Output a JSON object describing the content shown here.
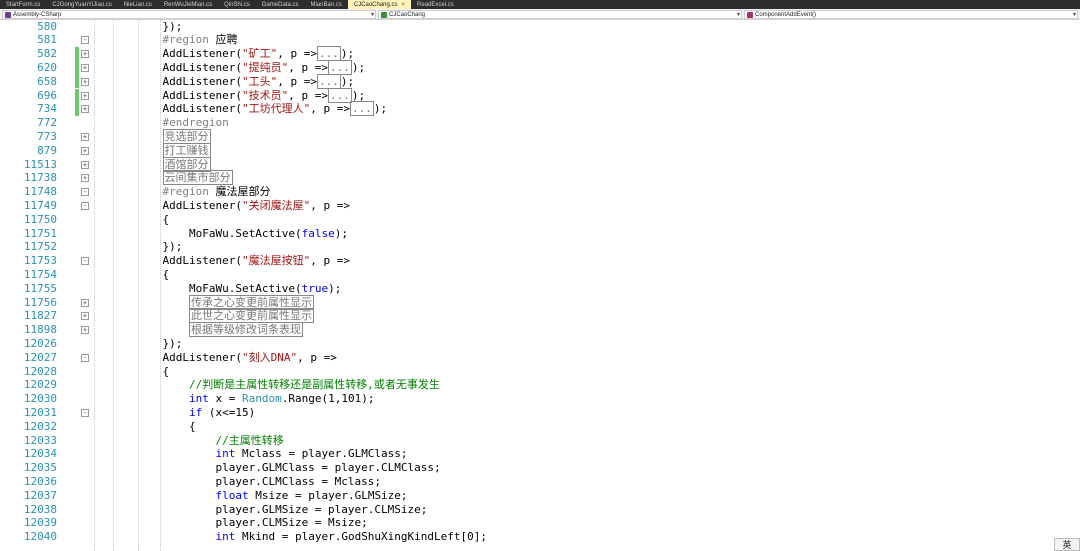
{
  "tabs": [
    {
      "label": "StartForm.cs",
      "active": false
    },
    {
      "label": "CJGongYuanYiJiao.cs",
      "active": false
    },
    {
      "label": "NieLian.cs",
      "active": false
    },
    {
      "label": "RenWuJieMian.cs",
      "active": false
    },
    {
      "label": "QinShi.cs",
      "active": false
    },
    {
      "label": "GameData.cs",
      "active": false
    },
    {
      "label": "MianBan.cs",
      "active": false
    },
    {
      "label": "CJCaoChang.cs",
      "active": true
    },
    {
      "label": "ReadExcel.cs",
      "active": false
    }
  ],
  "active_tab_close": "×",
  "navbar": {
    "project": "Assembly-CSharp",
    "class": "CJCaoChang",
    "member": "ComponentAddEvent()"
  },
  "ime_indicator": "英",
  "lines": [
    {
      "n": "580",
      "fold": "",
      "chg": false,
      "tokens": [
        {
          "t": "    });",
          "c": ""
        }
      ]
    },
    {
      "n": "581",
      "fold": "-",
      "chg": false,
      "tokens": [
        {
          "t": "    ",
          "c": ""
        },
        {
          "t": "#region",
          "c": "rg"
        },
        {
          "t": " 应聘",
          "c": ""
        }
      ]
    },
    {
      "n": "582",
      "fold": "+",
      "chg": true,
      "tokens": [
        {
          "t": "    AddListener(",
          "c": ""
        },
        {
          "t": "\"矿工\"",
          "c": "str"
        },
        {
          "t": ", p =>",
          "c": ""
        },
        {
          "t": "...",
          "c": "box"
        },
        {
          "t": ");",
          "c": ""
        }
      ]
    },
    {
      "n": "620",
      "fold": "+",
      "chg": true,
      "tokens": [
        {
          "t": "    AddListener(",
          "c": ""
        },
        {
          "t": "\"提纯员\"",
          "c": "str"
        },
        {
          "t": ", p =>",
          "c": ""
        },
        {
          "t": "...",
          "c": "box"
        },
        {
          "t": ");",
          "c": ""
        }
      ]
    },
    {
      "n": "658",
      "fold": "+",
      "chg": true,
      "tokens": [
        {
          "t": "    AddListener(",
          "c": ""
        },
        {
          "t": "\"工头\"",
          "c": "str"
        },
        {
          "t": ", p =>",
          "c": ""
        },
        {
          "t": "...",
          "c": "box"
        },
        {
          "t": ");",
          "c": ""
        }
      ]
    },
    {
      "n": "696",
      "fold": "+",
      "chg": true,
      "tokens": [
        {
          "t": "    AddListener(",
          "c": ""
        },
        {
          "t": "\"技术员\"",
          "c": "str"
        },
        {
          "t": ", p =>",
          "c": ""
        },
        {
          "t": "...",
          "c": "box"
        },
        {
          "t": ");",
          "c": ""
        }
      ]
    },
    {
      "n": "734",
      "fold": "+",
      "chg": true,
      "tokens": [
        {
          "t": "    AddListener(",
          "c": ""
        },
        {
          "t": "\"工坊代理人\"",
          "c": "str"
        },
        {
          "t": ", p =>",
          "c": ""
        },
        {
          "t": "...",
          "c": "box"
        },
        {
          "t": ");",
          "c": ""
        }
      ]
    },
    {
      "n": "772",
      "fold": "",
      "chg": false,
      "tokens": [
        {
          "t": "    ",
          "c": ""
        },
        {
          "t": "#endregion",
          "c": "rg"
        }
      ]
    },
    {
      "n": "773",
      "fold": "+",
      "chg": false,
      "tokens": [
        {
          "t": "    ",
          "c": ""
        },
        {
          "t": "竞选部分",
          "c": "box"
        }
      ]
    },
    {
      "n": "879",
      "fold": "+",
      "chg": false,
      "tokens": [
        {
          "t": "    ",
          "c": ""
        },
        {
          "t": "打工赚钱",
          "c": "box"
        }
      ]
    },
    {
      "n": "11513",
      "fold": "+",
      "chg": false,
      "tokens": [
        {
          "t": "    ",
          "c": ""
        },
        {
          "t": "酒馆部分",
          "c": "box"
        }
      ]
    },
    {
      "n": "11738",
      "fold": "+",
      "chg": false,
      "tokens": [
        {
          "t": "    ",
          "c": ""
        },
        {
          "t": "云间集市部分",
          "c": "box"
        }
      ]
    },
    {
      "n": "11748",
      "fold": "-",
      "chg": false,
      "tokens": [
        {
          "t": "    ",
          "c": ""
        },
        {
          "t": "#region",
          "c": "rg"
        },
        {
          "t": " 魔法屋部分",
          "c": ""
        }
      ]
    },
    {
      "n": "11749",
      "fold": "-",
      "chg": false,
      "tokens": [
        {
          "t": "    AddListener(",
          "c": ""
        },
        {
          "t": "\"关闭魔法屋\"",
          "c": "str"
        },
        {
          "t": ", p =>",
          "c": ""
        }
      ]
    },
    {
      "n": "11750",
      "fold": "",
      "chg": false,
      "tokens": [
        {
          "t": "    {",
          "c": ""
        }
      ]
    },
    {
      "n": "11751",
      "fold": "",
      "chg": false,
      "tokens": [
        {
          "t": "        MoFaWu.SetActive(",
          "c": ""
        },
        {
          "t": "false",
          "c": "kw"
        },
        {
          "t": ");",
          "c": ""
        }
      ]
    },
    {
      "n": "11752",
      "fold": "",
      "chg": false,
      "tokens": [
        {
          "t": "    });",
          "c": ""
        }
      ]
    },
    {
      "n": "11753",
      "fold": "-",
      "chg": false,
      "tokens": [
        {
          "t": "    AddListener(",
          "c": ""
        },
        {
          "t": "\"魔法屋按钮\"",
          "c": "str"
        },
        {
          "t": ", p =>",
          "c": ""
        }
      ]
    },
    {
      "n": "11754",
      "fold": "",
      "chg": false,
      "tokens": [
        {
          "t": "    {",
          "c": ""
        }
      ]
    },
    {
      "n": "11755",
      "fold": "",
      "chg": false,
      "tokens": [
        {
          "t": "        MoFaWu.SetActive(",
          "c": ""
        },
        {
          "t": "true",
          "c": "kw"
        },
        {
          "t": ");",
          "c": ""
        }
      ]
    },
    {
      "n": "11756",
      "fold": "+",
      "chg": false,
      "tokens": [
        {
          "t": "        ",
          "c": ""
        },
        {
          "t": "传承之心变更前属性显示",
          "c": "box"
        }
      ]
    },
    {
      "n": "11827",
      "fold": "+",
      "chg": false,
      "tokens": [
        {
          "t": "        ",
          "c": ""
        },
        {
          "t": "此世之心变更前属性显示",
          "c": "box"
        }
      ]
    },
    {
      "n": "11898",
      "fold": "+",
      "chg": false,
      "tokens": [
        {
          "t": "        ",
          "c": ""
        },
        {
          "t": "根据等级修改词条表现",
          "c": "box"
        }
      ]
    },
    {
      "n": "12026",
      "fold": "",
      "chg": false,
      "tokens": [
        {
          "t": "    });",
          "c": ""
        }
      ]
    },
    {
      "n": "12027",
      "fold": "-",
      "chg": false,
      "tokens": [
        {
          "t": "    AddListener(",
          "c": ""
        },
        {
          "t": "\"刻入DNA\"",
          "c": "str"
        },
        {
          "t": ", p =>",
          "c": ""
        }
      ]
    },
    {
      "n": "12028",
      "fold": "",
      "chg": false,
      "tokens": [
        {
          "t": "    {",
          "c": ""
        }
      ]
    },
    {
      "n": "12029",
      "fold": "",
      "chg": false,
      "tokens": [
        {
          "t": "        ",
          "c": ""
        },
        {
          "t": "//判断是主属性转移还是副属性转移,或者无事发生",
          "c": "cmt"
        }
      ]
    },
    {
      "n": "12030",
      "fold": "",
      "chg": false,
      "tokens": [
        {
          "t": "        ",
          "c": ""
        },
        {
          "t": "int",
          "c": "kw"
        },
        {
          "t": " x = ",
          "c": ""
        },
        {
          "t": "Random",
          "c": "ty"
        },
        {
          "t": ".Range(1,101);",
          "c": ""
        }
      ]
    },
    {
      "n": "12031",
      "fold": "-",
      "chg": false,
      "tokens": [
        {
          "t": "        ",
          "c": ""
        },
        {
          "t": "if",
          "c": "kw"
        },
        {
          "t": " (x<=15)",
          "c": ""
        }
      ]
    },
    {
      "n": "12032",
      "fold": "",
      "chg": false,
      "tokens": [
        {
          "t": "        {",
          "c": ""
        }
      ]
    },
    {
      "n": "12033",
      "fold": "",
      "chg": false,
      "tokens": [
        {
          "t": "            ",
          "c": ""
        },
        {
          "t": "//主属性转移",
          "c": "cmt"
        }
      ]
    },
    {
      "n": "12034",
      "fold": "",
      "chg": false,
      "tokens": [
        {
          "t": "            ",
          "c": ""
        },
        {
          "t": "int",
          "c": "kw"
        },
        {
          "t": " Mclass = player.GLMClass;",
          "c": ""
        }
      ]
    },
    {
      "n": "12035",
      "fold": "",
      "chg": false,
      "tokens": [
        {
          "t": "            player.GLMClass = player.CLMClass;",
          "c": ""
        }
      ]
    },
    {
      "n": "12036",
      "fold": "",
      "chg": false,
      "tokens": [
        {
          "t": "            player.CLMClass = Mclass;",
          "c": ""
        }
      ]
    },
    {
      "n": "12037",
      "fold": "",
      "chg": false,
      "tokens": [
        {
          "t": "            ",
          "c": ""
        },
        {
          "t": "float",
          "c": "kw"
        },
        {
          "t": " Msize = player.GLMSize;",
          "c": ""
        }
      ]
    },
    {
      "n": "12038",
      "fold": "",
      "chg": false,
      "tokens": [
        {
          "t": "            player.GLMSize = player.CLMSize;",
          "c": ""
        }
      ]
    },
    {
      "n": "12039",
      "fold": "",
      "chg": false,
      "tokens": [
        {
          "t": "            player.CLMSize = Msize;",
          "c": ""
        }
      ]
    },
    {
      "n": "12040",
      "fold": "",
      "chg": false,
      "tokens": [
        {
          "t": "            ",
          "c": ""
        },
        {
          "t": "int",
          "c": "kw"
        },
        {
          "t": " Mkind = player.GodShuXingKindLeft[0];",
          "c": ""
        }
      ]
    }
  ]
}
